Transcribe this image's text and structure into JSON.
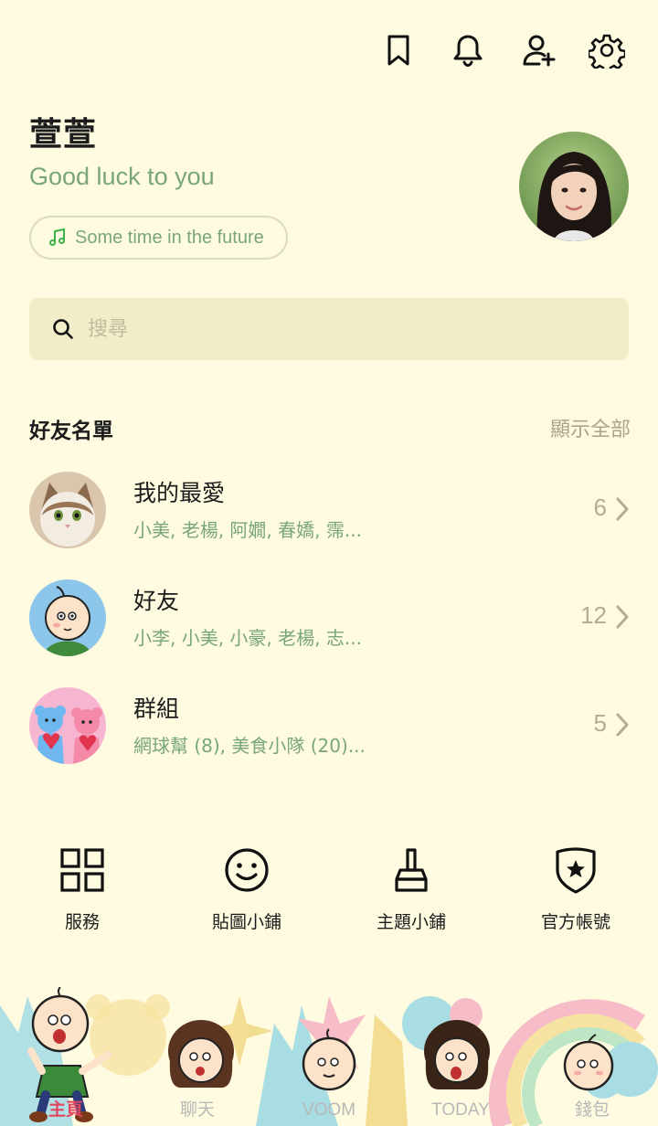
{
  "header": {
    "icons": [
      "bookmark-icon",
      "bell-icon",
      "add-friend-icon",
      "gear-icon"
    ]
  },
  "profile": {
    "name": "萱萱",
    "status_message": "Good luck to you",
    "music": "Some time in the future"
  },
  "search": {
    "placeholder": "搜尋"
  },
  "friends_section": {
    "title": "好友名單",
    "show_all": "顯示全部",
    "rows": [
      {
        "title": "我的最愛",
        "subtitle": "小美, 老楊, 阿嫺, 春嬌, 霈...",
        "count": "6"
      },
      {
        "title": "好友",
        "subtitle": "小李, 小美, 小豪, 老楊, 志...",
        "count": "12"
      },
      {
        "title": "群組",
        "subtitle": "網球幫 (8), 美食小隊 (20)...",
        "count": "5"
      }
    ]
  },
  "services": [
    {
      "label": "服務",
      "icon": "grid-icon"
    },
    {
      "label": "貼圖小鋪",
      "icon": "smiley-icon"
    },
    {
      "label": "主題小鋪",
      "icon": "brush-icon"
    },
    {
      "label": "官方帳號",
      "icon": "shield-star-icon"
    }
  ],
  "tabs": [
    {
      "label": "主頁",
      "active": true
    },
    {
      "label": "聊天",
      "active": false
    },
    {
      "label": "VOOM",
      "active": false
    },
    {
      "label": "TODAY",
      "active": false
    },
    {
      "label": "錢包",
      "active": false
    }
  ],
  "colors": {
    "background": "#fffbe0",
    "accent_green": "#79a679",
    "active_tab": "#e2465e"
  }
}
